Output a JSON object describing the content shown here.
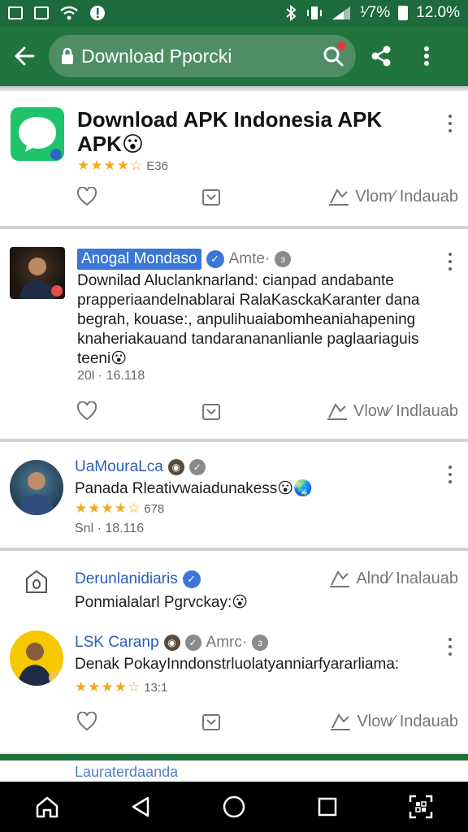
{
  "status": {
    "right_text_1": "¹⁄7%",
    "right_text_2": "12.0%"
  },
  "search": {
    "query": "Download Pporcki"
  },
  "cards": [
    {
      "title": "Download APK Indonesia APK APK😮",
      "stars": "★★★★☆",
      "rating_count": "E36",
      "actions": {
        "download_label": "Vlom⁄ Indauab"
      }
    },
    {
      "author": "Anogal Mondaso",
      "tag": "Amte·",
      "body": "Downilad Aluclanknarland: cianpad andabante prapperiaandelnablarai RalaKasckaKaranter dana begrah, kouase:, anpulihuaiabomheaniahapening knaheriakauand tandaranananlianle paglaariaguis teeni😮",
      "meta": "20l · 16.118",
      "actions": {
        "download_label": "Vlow⁄ Indlauab"
      }
    },
    {
      "author": "UaMouraLca",
      "body": "Panada Rleativwaiadunakess😮🌏",
      "stars": "★★★★☆",
      "rating_count": "678",
      "meta": "Snl · 18.116"
    },
    {
      "author": "Derunlanidiaris",
      "body": "Ponmialalarl Pgrvckay:😮",
      "download_label": "Alnd⁄ Inalauab"
    },
    {
      "author": "LSK Caranp",
      "tag": "Amrc·",
      "body": "Denak PokayInndonstrluolatyanniarfyararliama:",
      "stars": "★★★★☆",
      "rating_count": "13:1",
      "actions": {
        "download_label": "Vlow⁄ Indauab"
      }
    }
  ],
  "peek": {
    "text": "Lauraterdaanda"
  },
  "colors": {
    "appbar": "#22743f",
    "statusbar": "#1d6a3c",
    "accent_blue": "#2a5fb5",
    "star": "#f2a81d"
  },
  "icons": [
    "back-arrow-icon",
    "lock-icon",
    "search-icon",
    "share-icon",
    "more-vert-icon",
    "heart-icon",
    "bookmark-icon",
    "download-link-icon",
    "home-icon",
    "nav-back-icon",
    "nav-home-icon",
    "recents-icon",
    "scan-icon"
  ]
}
